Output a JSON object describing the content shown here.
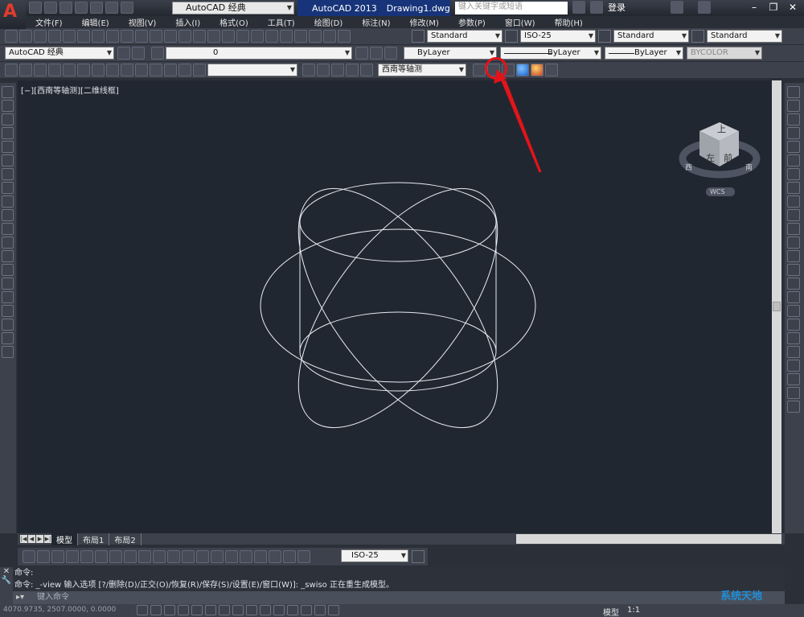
{
  "title_bar": {
    "workspace": "AutoCAD 经典",
    "app_name": "AutoCAD 2013",
    "document": "Drawing1.dwg",
    "search_placeholder": "键入关键字或短语",
    "login": "登录"
  },
  "menu": [
    "文件(F)",
    "编辑(E)",
    "视图(V)",
    "插入(I)",
    "格式(O)",
    "工具(T)",
    "绘图(D)",
    "标注(N)",
    "修改(M)",
    "参数(P)",
    "窗口(W)",
    "帮助(H)"
  ],
  "styles_toolbar": {
    "text_style": "Standard",
    "dim_style": "ISO-25",
    "table_style": "Standard",
    "multileader_style": "Standard"
  },
  "layers_toolbar": {
    "workspace": "AutoCAD 经典",
    "layer": "0",
    "color": "ByLayer",
    "linetype": "ByLayer",
    "lineweight": "ByLayer",
    "plot_style": "BYCOLOR"
  },
  "view_toolbar": {
    "named_view": "",
    "view_preset": "西南等轴测"
  },
  "viewport": {
    "label": "[−][西南等轴测][二维线框]",
    "viewcube_top": "上",
    "viewcube_left": "左",
    "viewcube_front": "前",
    "compass_west": "西",
    "compass_south": "南",
    "ucs": "WCS"
  },
  "tabs": [
    "模型",
    "布局1",
    "布局2"
  ],
  "dim_toolbar": {
    "dim_style": "ISO-25"
  },
  "command": {
    "line1": "命令:",
    "line2": "命令: _-view 输入选项 [?/删除(D)/正交(O)/恢复(R)/保存(S)/设置(E)/窗口(W)]: _swiso 正在重生成模型。",
    "input_placeholder": "键入命令"
  },
  "status": {
    "coords": "4070.9735,  2507.0000,  0.0000",
    "model": "模型",
    "scale": "1:1"
  },
  "watermark": "系统天地",
  "colors": {
    "highlight": "#e2141a",
    "title_blue": "#17347a"
  }
}
